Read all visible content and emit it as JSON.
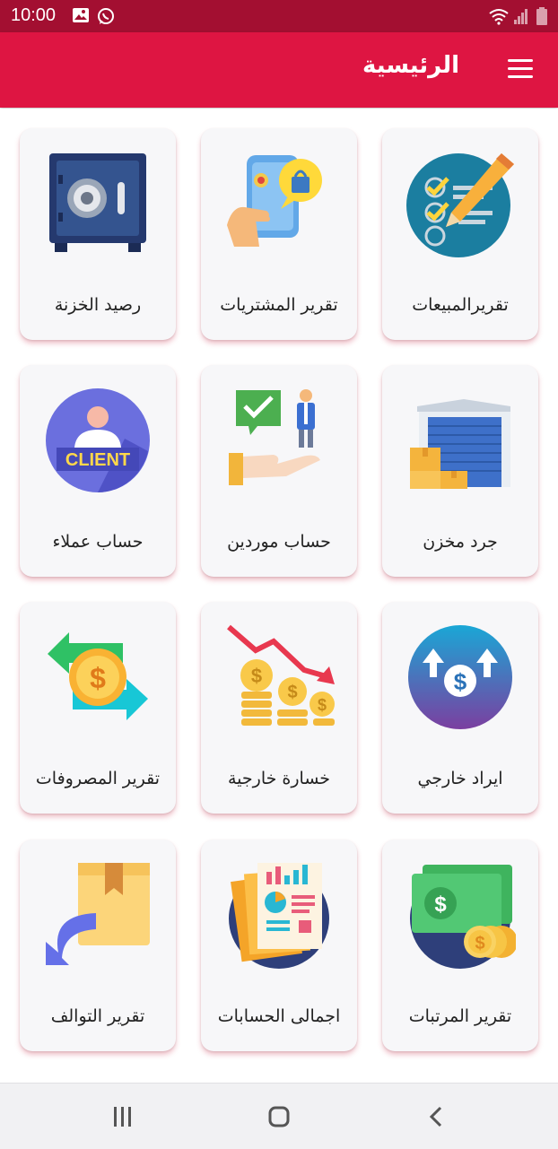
{
  "status_bar": {
    "time": "10:00",
    "left_icons": [
      "image-icon",
      "whatsapp-icon"
    ],
    "right_icons": [
      "wifi-icon",
      "signal-icon",
      "battery-icon"
    ]
  },
  "app_bar": {
    "title": "الرئيسية",
    "menu_icon": "hamburger-menu-icon",
    "color": "#de1542"
  },
  "menu_items": [
    {
      "label": "رصيد الخزنة",
      "icon": "safe-icon"
    },
    {
      "label": "تقرير المشتريات",
      "icon": "mobile-shopping-icon"
    },
    {
      "label": "تقريرالمبيعات",
      "icon": "checklist-pencil-icon"
    },
    {
      "label": "حساب عملاء",
      "icon": "client-icon"
    },
    {
      "label": "حساب موردين",
      "icon": "supplier-handshake-icon"
    },
    {
      "label": "جرد مخزن",
      "icon": "warehouse-icon"
    },
    {
      "label": "تقرير المصروفات",
      "icon": "money-exchange-icon"
    },
    {
      "label": "خسارة خارجية",
      "icon": "loss-coins-icon"
    },
    {
      "label": "ايراد خارجي",
      "icon": "income-arrows-icon"
    },
    {
      "label": "تقرير التوالف",
      "icon": "damaged-box-icon"
    },
    {
      "label": "اجمالى الحسابات",
      "icon": "accounts-report-icon"
    },
    {
      "label": "تقرير المرتبات",
      "icon": "salary-cash-icon"
    }
  ],
  "nav_bar": {
    "buttons": [
      "recent-apps-icon",
      "home-icon",
      "back-icon"
    ]
  }
}
